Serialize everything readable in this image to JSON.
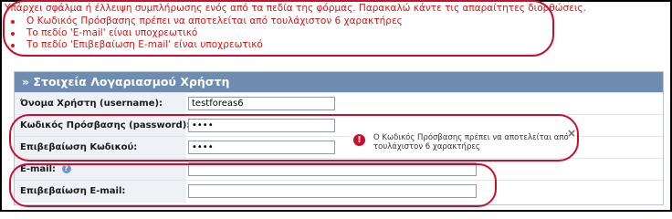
{
  "errors": {
    "header": "Υπάρχει σφάλμα ή έλλειψη συμπλήρωσης ενός από τα πεδία της φόρμας. Παρακαλώ κάντε τις απαραίτητες διορθώσεις.",
    "items": [
      "Ο Κωδικός Πρόσβασης πρέπει να αποτελείται από τουλάχιστον 6 χαρακτήρες",
      "Το πεδίο 'E-mail' είναι υποχρεωτικό",
      "Το πεδίο 'Επιβεβαίωση E-mail' είναι υποχρεωτικό"
    ]
  },
  "panel": {
    "title": "» Στοιχεία Λογαριασμού Χρήστη",
    "rows": [
      {
        "label": "Όνομα Χρήστη (username):",
        "value": ""
      },
      {
        "label": "Κωδικός Πρόσβασης (password):",
        "value": ""
      },
      {
        "label": "Επιβεβαίωση Κωδικού:",
        "value": ""
      },
      {
        "label": "E-mail:",
        "value": ""
      },
      {
        "label": "Επιβεβαίωση E-mail:",
        "value": ""
      }
    ]
  },
  "fields": {
    "username": "testforeas6",
    "password": "••••",
    "password_confirm": "••••",
    "email": "",
    "email_confirm": ""
  },
  "tooltip": {
    "text": "Ο Κωδικός Πρόσβασης πρέπει να αποτελείται από τουλάχιστον 6 χαρακτήρες",
    "icon": "!",
    "close": "×"
  },
  "colors": {
    "error_text": "#d01818",
    "highlight_circle": "#c8102e",
    "panel_header": "#6d8cb0"
  }
}
